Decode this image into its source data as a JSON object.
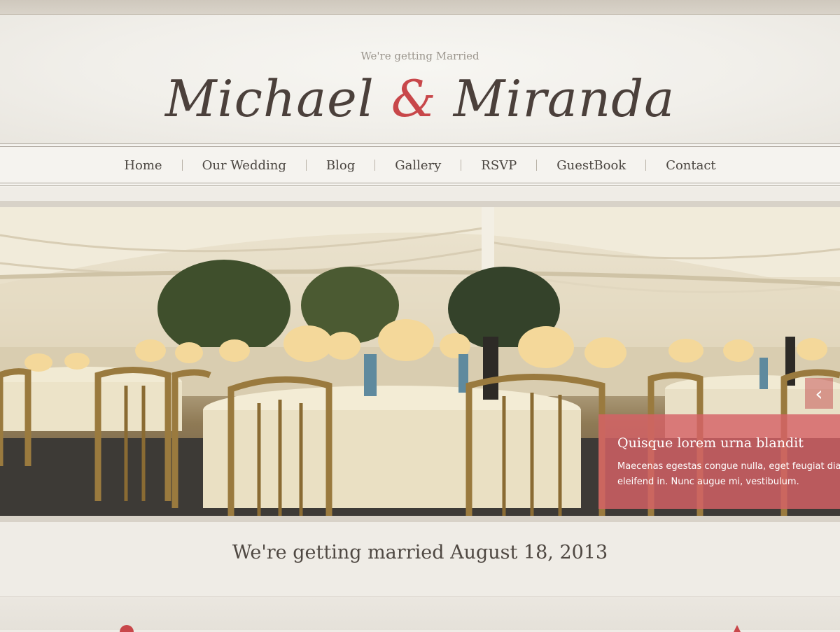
{
  "header": {
    "tagline": "We're getting Married",
    "name_first": "Michael",
    "name_amp": "&",
    "name_second": "Miranda"
  },
  "nav": {
    "items": [
      "Home",
      "Our Wedding",
      "Blog",
      "Gallery",
      "RSVP",
      "GuestBook",
      "Contact"
    ]
  },
  "slider": {
    "caption_title": "Quisque lorem urna blandit",
    "caption_line1": "Maecenas egestas congue nulla, eget feugiat diam",
    "caption_line2": "eleifend in. Nunc augue mi, vestibulum.",
    "prev_glyph": "‹"
  },
  "main": {
    "date_text": "We're getting married August 18, 2013"
  },
  "colors": {
    "accent": "#c8474a",
    "caption_bg": "#d66267",
    "text": "#4a4540"
  }
}
